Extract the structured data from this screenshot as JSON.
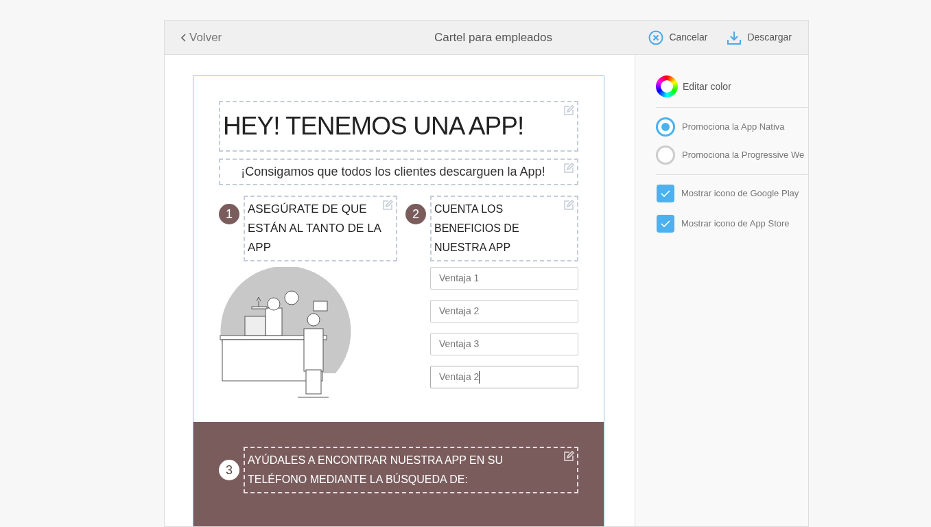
{
  "header": {
    "back_label": "Volver",
    "title": "Cartel para empleados",
    "actions": [
      {
        "kind": "cancel",
        "label": "Cancelar"
      },
      {
        "kind": "download",
        "label": "Descargar"
      }
    ]
  },
  "poster": {
    "title": "HEY! TENEMOS UNA APP!",
    "subtitle": "¡Consigamos que todos los clientes descarguen la App!",
    "steps": [
      {
        "number": "1",
        "heading": "ASEGÚRATE DE QUE ESTÁN AL TANTO DE LA APP"
      },
      {
        "number": "2",
        "heading": "CUENTA LOS BENEFICIOS DE NUESTRA APP"
      }
    ],
    "fields": [
      {
        "value": "Ventaja 1",
        "focused": false
      },
      {
        "value": "Ventaja 2",
        "focused": false
      },
      {
        "value": "Ventaja 3",
        "focused": false
      },
      {
        "value": "Ventaja 2",
        "focused": true
      }
    ],
    "search_step": {
      "number": "3",
      "heading": "AYÚDALES A ENCONTRAR NUESTRA APP EN SU TELÉFONO MEDIANTE LA BÚSQUEDA DE:"
    }
  },
  "sidebar": {
    "color_label": "Editar color",
    "options": [
      {
        "label": "Promociona la App Nativa",
        "selected": true
      },
      {
        "label": "Promociona la Progressive We",
        "selected": false
      }
    ],
    "checkboxes": [
      {
        "label": "Mostrar icono de Google Play",
        "checked": true
      },
      {
        "label": "Mostrar icono de App Store",
        "checked": true
      }
    ]
  }
}
